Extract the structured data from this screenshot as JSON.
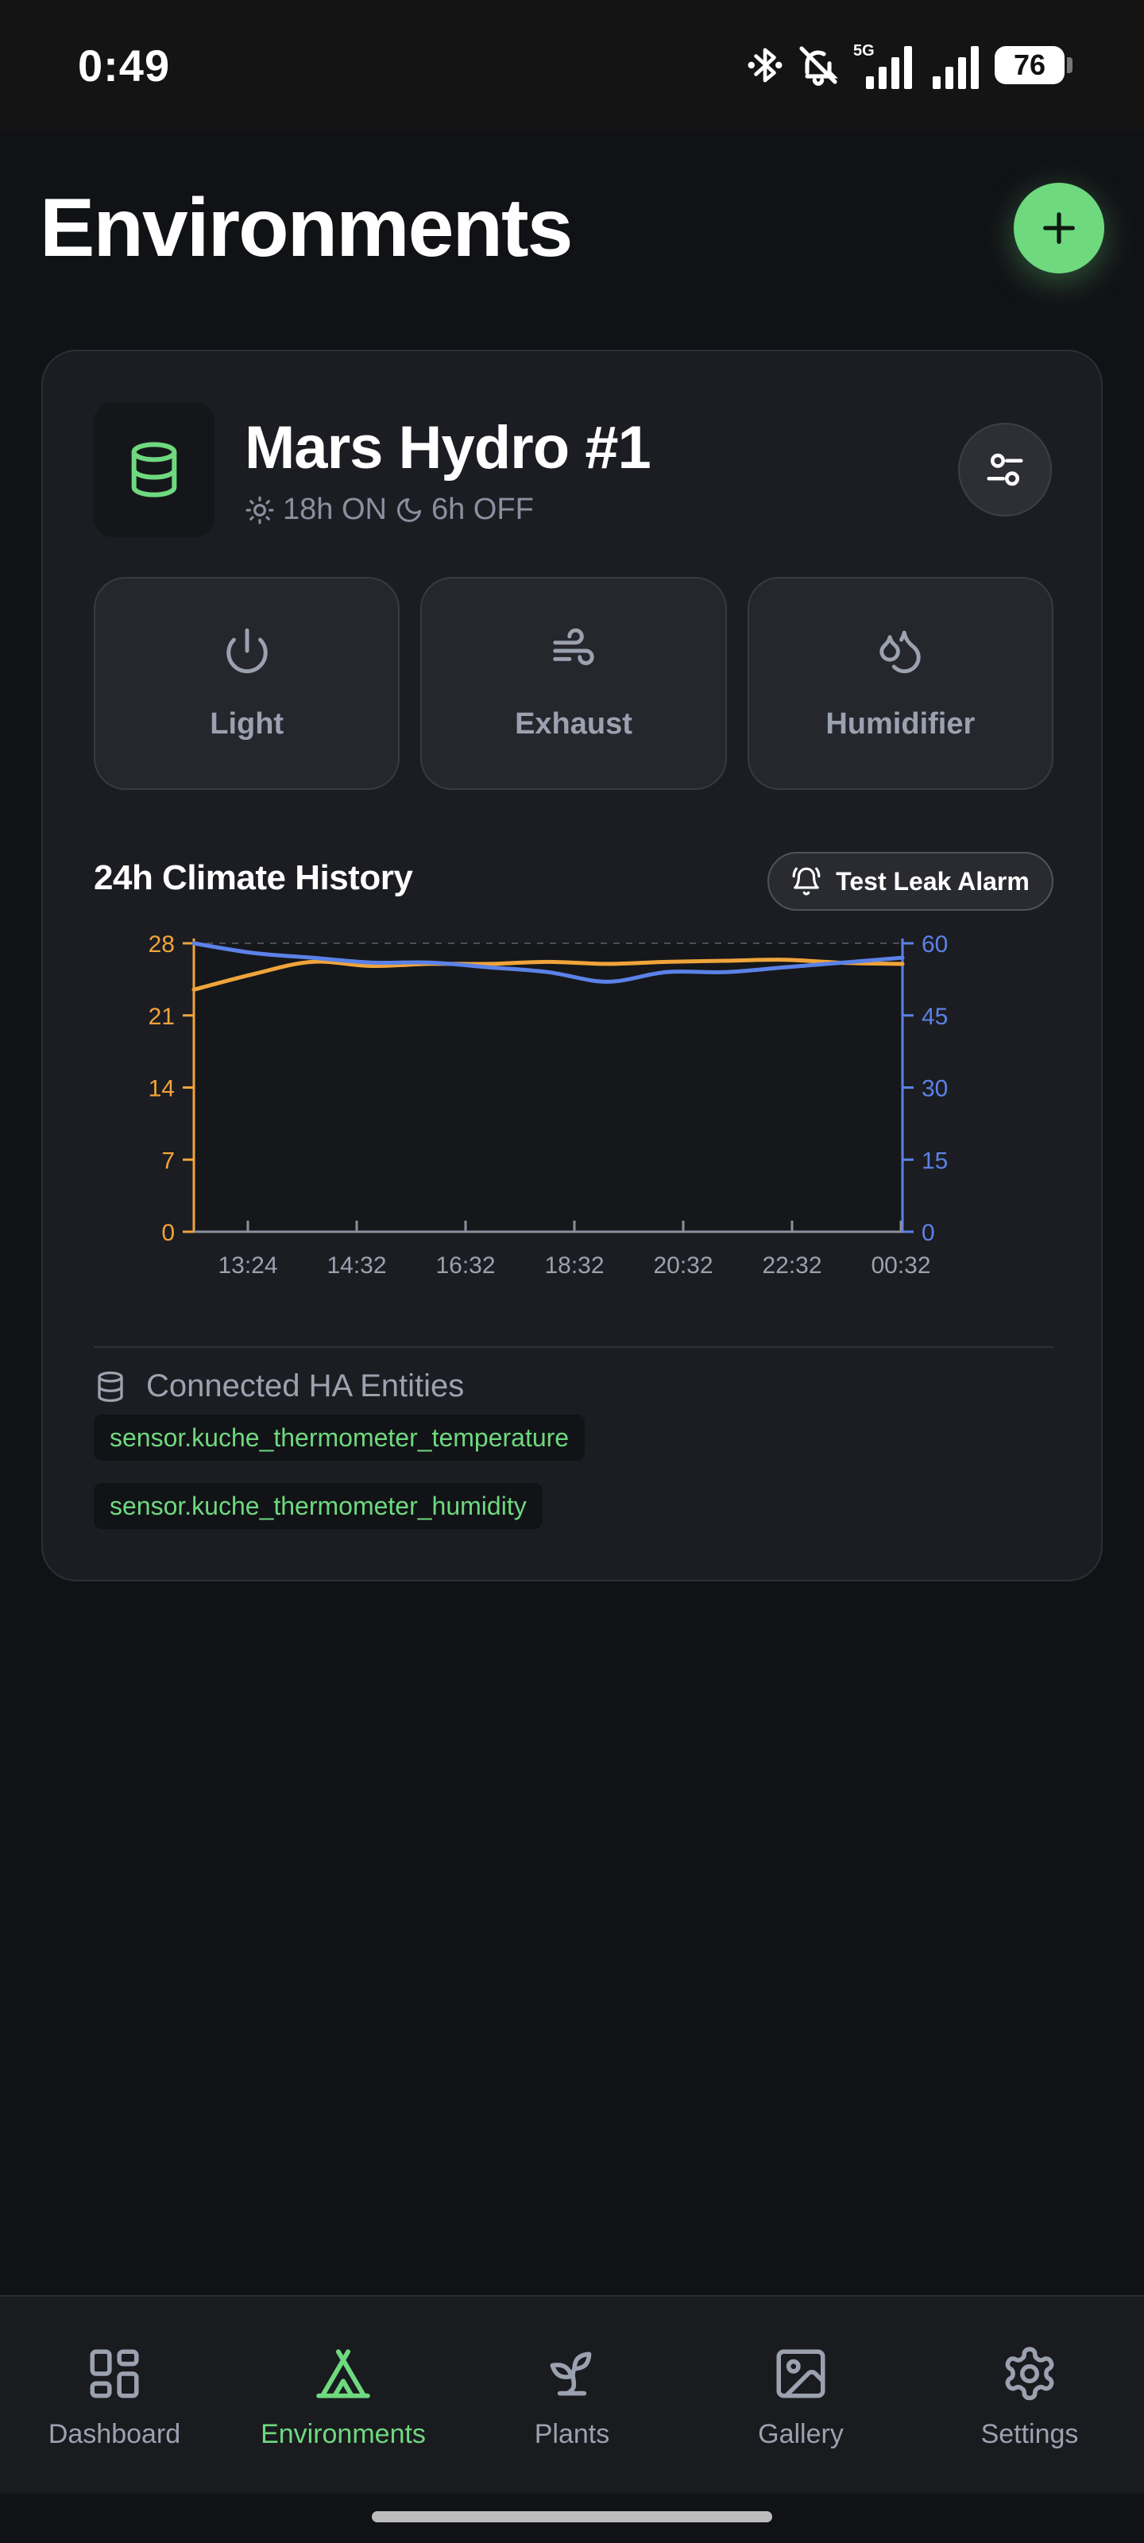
{
  "status_bar": {
    "time": "0:49",
    "network": "5G",
    "battery": "76"
  },
  "header": {
    "title": "Environments",
    "add_icon": "plus-icon"
  },
  "environment": {
    "name": "Mars Hydro #1",
    "icon": "database-icon",
    "light_on": "18h ON",
    "light_off": "6h OFF",
    "devices": [
      {
        "label": "Light",
        "icon": "power-icon"
      },
      {
        "label": "Exhaust",
        "icon": "wind-icon"
      },
      {
        "label": "Humidifier",
        "icon": "droplets-icon"
      }
    ],
    "history_title": "24h Climate History",
    "leak_alarm_label": "Test Leak Alarm",
    "entities_title": "Connected HA Entities",
    "entities": [
      "sensor.kuche_thermometer_temperature",
      "sensor.kuche_thermometer_humidity"
    ]
  },
  "colors": {
    "accent": "#6ed97f",
    "temperature": "#f0a43a",
    "humidity": "#5b82e8"
  },
  "chart_data": {
    "type": "line",
    "title": "24h Climate History",
    "x": [
      "13:24",
      "14:32",
      "16:32",
      "18:32",
      "20:32",
      "22:32",
      "00:32"
    ],
    "y_left_ticks": [
      0,
      7,
      14,
      21,
      28
    ],
    "y_right_ticks": [
      0,
      15,
      30,
      45,
      60
    ],
    "ylim_left": [
      0,
      28
    ],
    "ylim_right": [
      0,
      60
    ],
    "reference_line": 28,
    "series": [
      {
        "axis": "left",
        "values": [
          23.5,
          25.0,
          26.2,
          25.8,
          26.0,
          26.0,
          26.2,
          26.0,
          26.2,
          26.3,
          26.4,
          26.1,
          26.0
        ]
      },
      {
        "axis": "right",
        "values": [
          60,
          58,
          57,
          56,
          56,
          55,
          54,
          52,
          54,
          54,
          55,
          56,
          57
        ]
      }
    ]
  },
  "nav": [
    {
      "label": "Dashboard",
      "icon": "dashboard-icon",
      "active": false
    },
    {
      "label": "Environments",
      "icon": "tent-icon",
      "active": true
    },
    {
      "label": "Plants",
      "icon": "sprout-icon",
      "active": false
    },
    {
      "label": "Gallery",
      "icon": "image-icon",
      "active": false
    },
    {
      "label": "Settings",
      "icon": "gear-icon",
      "active": false
    }
  ]
}
